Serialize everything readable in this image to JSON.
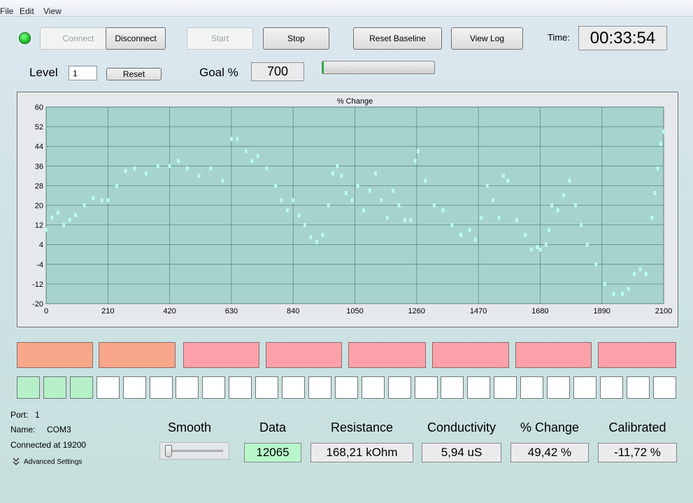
{
  "menu": {
    "file": "File",
    "edit": "Edit",
    "view": "View"
  },
  "toolbar": {
    "connect": "Connect",
    "disconnect": "Disconnect",
    "start": "Start",
    "stop": "Stop",
    "reset_baseline": "Reset Baseline",
    "view_log": "View Log",
    "status_color": "#1fd12f"
  },
  "time": {
    "label": "Time:",
    "value": "00:33:54"
  },
  "level": {
    "label": "Level",
    "value": "1",
    "reset": "Reset"
  },
  "goal": {
    "label": "Goal %",
    "value": "700",
    "progress": 0.01
  },
  "chart_data": {
    "type": "scatter",
    "title": "% Change",
    "xlabel": "",
    "ylabel": "",
    "xlim": [
      0,
      2100
    ],
    "ylim": [
      -20,
      60
    ],
    "x_ticks": [
      0,
      210,
      420,
      630,
      840,
      1050,
      1260,
      1470,
      1680,
      1890,
      2100
    ],
    "y_ticks": [
      60,
      52,
      44,
      36,
      28,
      20,
      12,
      4,
      -4,
      -12,
      -20
    ],
    "grid": true,
    "marker_color": "#b8f9f3",
    "plot_bg": "#a6d3cc",
    "series": [
      {
        "x": [
          0,
          20,
          40,
          60,
          80,
          100,
          130,
          160,
          190,
          210,
          240,
          270,
          300,
          340,
          380,
          420,
          450,
          480,
          520,
          560,
          600,
          630,
          650,
          680,
          700,
          720,
          750,
          780,
          800,
          820,
          840,
          860,
          880,
          900,
          920,
          940,
          960,
          975,
          990,
          1005,
          1020,
          1040,
          1060,
          1080,
          1100,
          1120,
          1140,
          1160,
          1180,
          1200,
          1220,
          1240,
          1255,
          1265,
          1290,
          1320,
          1350,
          1380,
          1410,
          1440,
          1460,
          1480,
          1500,
          1520,
          1540,
          1555,
          1570,
          1600,
          1630,
          1650,
          1670,
          1680,
          1700,
          1710,
          1720,
          1740,
          1760,
          1780,
          1800,
          1820,
          1840,
          1870,
          1900,
          1930,
          1960,
          1980,
          2000,
          2020,
          2040,
          2060,
          2070,
          2080,
          2090,
          2100
        ],
        "y": [
          10,
          15,
          17,
          12,
          14,
          16,
          20,
          23,
          22,
          22,
          28,
          34,
          35,
          33,
          36,
          36,
          38,
          35,
          32,
          35,
          30,
          47,
          47,
          42,
          38,
          40,
          35,
          28,
          22,
          18,
          22,
          16,
          12,
          7,
          5,
          8,
          20,
          33,
          36,
          32,
          25,
          22,
          28,
          18,
          26,
          33,
          22,
          15,
          26,
          20,
          14,
          14,
          38,
          42,
          30,
          20,
          18,
          12,
          8,
          10,
          6,
          15,
          28,
          22,
          15,
          32,
          30,
          14,
          8,
          2,
          3,
          2,
          4,
          10,
          20,
          18,
          24,
          30,
          20,
          12,
          4,
          -4,
          -12,
          -16,
          -16,
          -14,
          -8,
          -6,
          -8,
          15,
          25,
          35,
          45,
          50
        ]
      }
    ]
  },
  "tiles": [
    {
      "color": "#f9a78a"
    },
    {
      "color": "#f9a78a"
    },
    {
      "color": "#fca1aa"
    },
    {
      "color": "#fca1aa"
    },
    {
      "color": "#fca1aa"
    },
    {
      "color": "#fca1aa"
    },
    {
      "color": "#fca1aa"
    },
    {
      "color": "#fca1aa"
    }
  ],
  "squares": [
    true,
    true,
    true,
    false,
    false,
    false,
    false,
    false,
    false,
    false,
    false,
    false,
    false,
    false,
    false,
    false,
    false,
    false,
    false,
    false,
    false,
    false,
    false,
    false,
    false
  ],
  "port": {
    "port_label": "Port:",
    "port_value": "1",
    "name_label": "Name:",
    "name_value": "COM3",
    "connected": "Connected at 19200",
    "advanced": "Advanced Settings"
  },
  "smooth": {
    "label": "Smooth",
    "level": 0.0
  },
  "readouts": {
    "data_label": "Data",
    "data_value": "12065",
    "resistance_label": "Resistance",
    "resistance_value": "168,21 kOhm",
    "conductivity_label": "Conductivity",
    "conductivity_value": "5,94 uS",
    "change_label": "% Change",
    "change_value": "49,42 %",
    "calibrated_label": "Calibrated",
    "calibrated_value": "-11,72 %"
  }
}
